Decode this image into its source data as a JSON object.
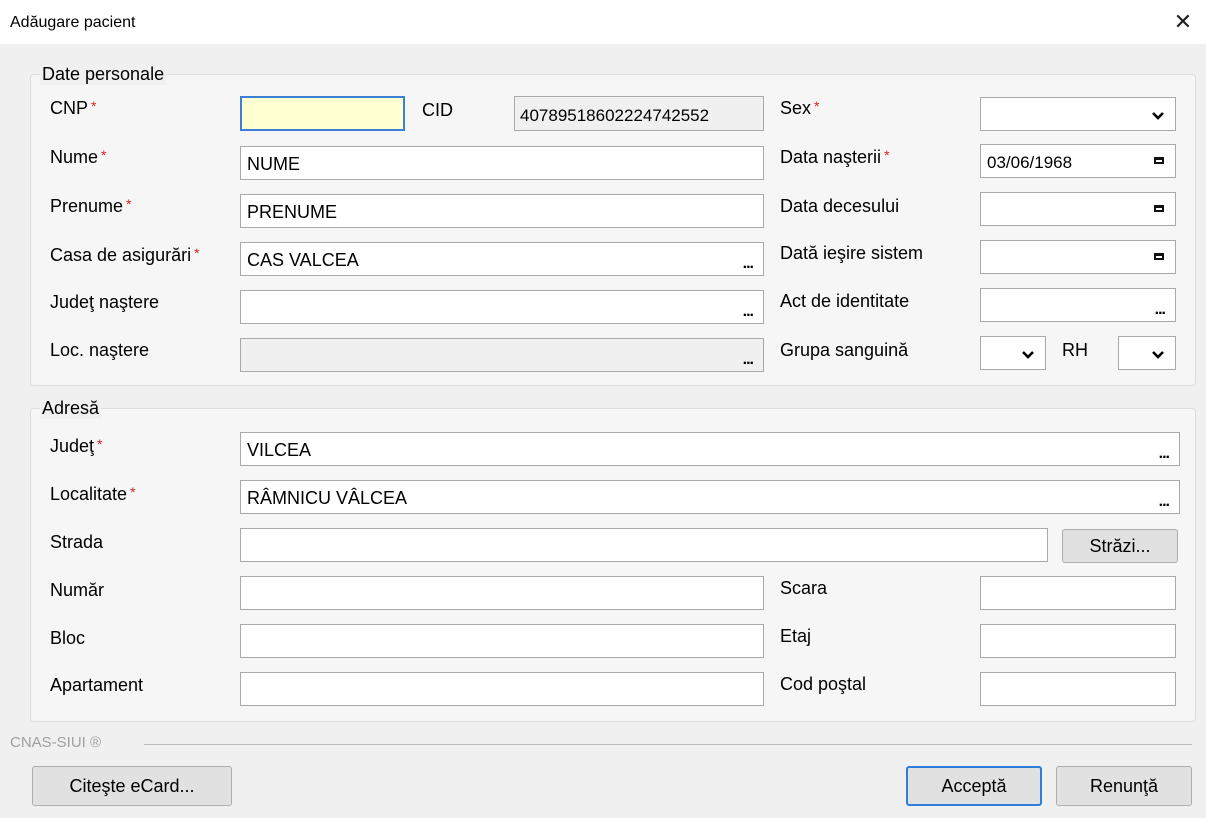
{
  "window": {
    "title": "Adăugare pacient",
    "close_glyph": "✕"
  },
  "personal": {
    "legend": "Date personale",
    "required_mark": "*",
    "cnp": {
      "label": "CNP",
      "value": ""
    },
    "cid": {
      "label": "CID",
      "value": "40789518602224742552"
    },
    "nume": {
      "label": "Nume",
      "value": "NUME"
    },
    "prenume": {
      "label": "Prenume",
      "value": "PRENUME"
    },
    "casa": {
      "label": "Casa de asigurări",
      "value": "CAS VALCEA"
    },
    "judet_nastere": {
      "label": "Judeţ naştere",
      "value": ""
    },
    "loc_nastere": {
      "label": "Loc. naştere",
      "value": ""
    },
    "sex": {
      "label": "Sex",
      "value": ""
    },
    "data_nasterii": {
      "label": "Data naşterii",
      "value": "03/06/1968"
    },
    "data_decesului": {
      "label": "Data decesului",
      "value": ""
    },
    "data_iesire": {
      "label": "Dată ieşire sistem",
      "value": ""
    },
    "act": {
      "label": "Act de identitate",
      "value": ""
    },
    "grupa": {
      "label": "Grupa sanguină",
      "value": ""
    },
    "rh": {
      "label": "RH",
      "value": ""
    },
    "ellipsis": "..."
  },
  "address": {
    "legend": "Adresă",
    "judet": {
      "label": "Judeţ",
      "value": "VILCEA"
    },
    "localitate": {
      "label": "Localitate",
      "value": "RÂMNICU VÂLCEA"
    },
    "strada": {
      "label": "Strada",
      "value": ""
    },
    "strazi_button": "Străzi...",
    "numar": {
      "label": "Număr",
      "value": ""
    },
    "bloc": {
      "label": "Bloc",
      "value": ""
    },
    "apartament": {
      "label": "Apartament",
      "value": ""
    },
    "scara": {
      "label": "Scara",
      "value": ""
    },
    "etaj": {
      "label": "Etaj",
      "value": ""
    },
    "cod_postal": {
      "label": "Cod poştal",
      "value": ""
    }
  },
  "footer": {
    "brand": "CNAS-SIUI ®",
    "read_card": "Citeşte eCard...",
    "accept": "Acceptă",
    "cancel": "Renunţă"
  },
  "colors": {
    "accent": "#2f7ed8",
    "required": "#e02020",
    "cnp_bg": "#ffffd2"
  }
}
